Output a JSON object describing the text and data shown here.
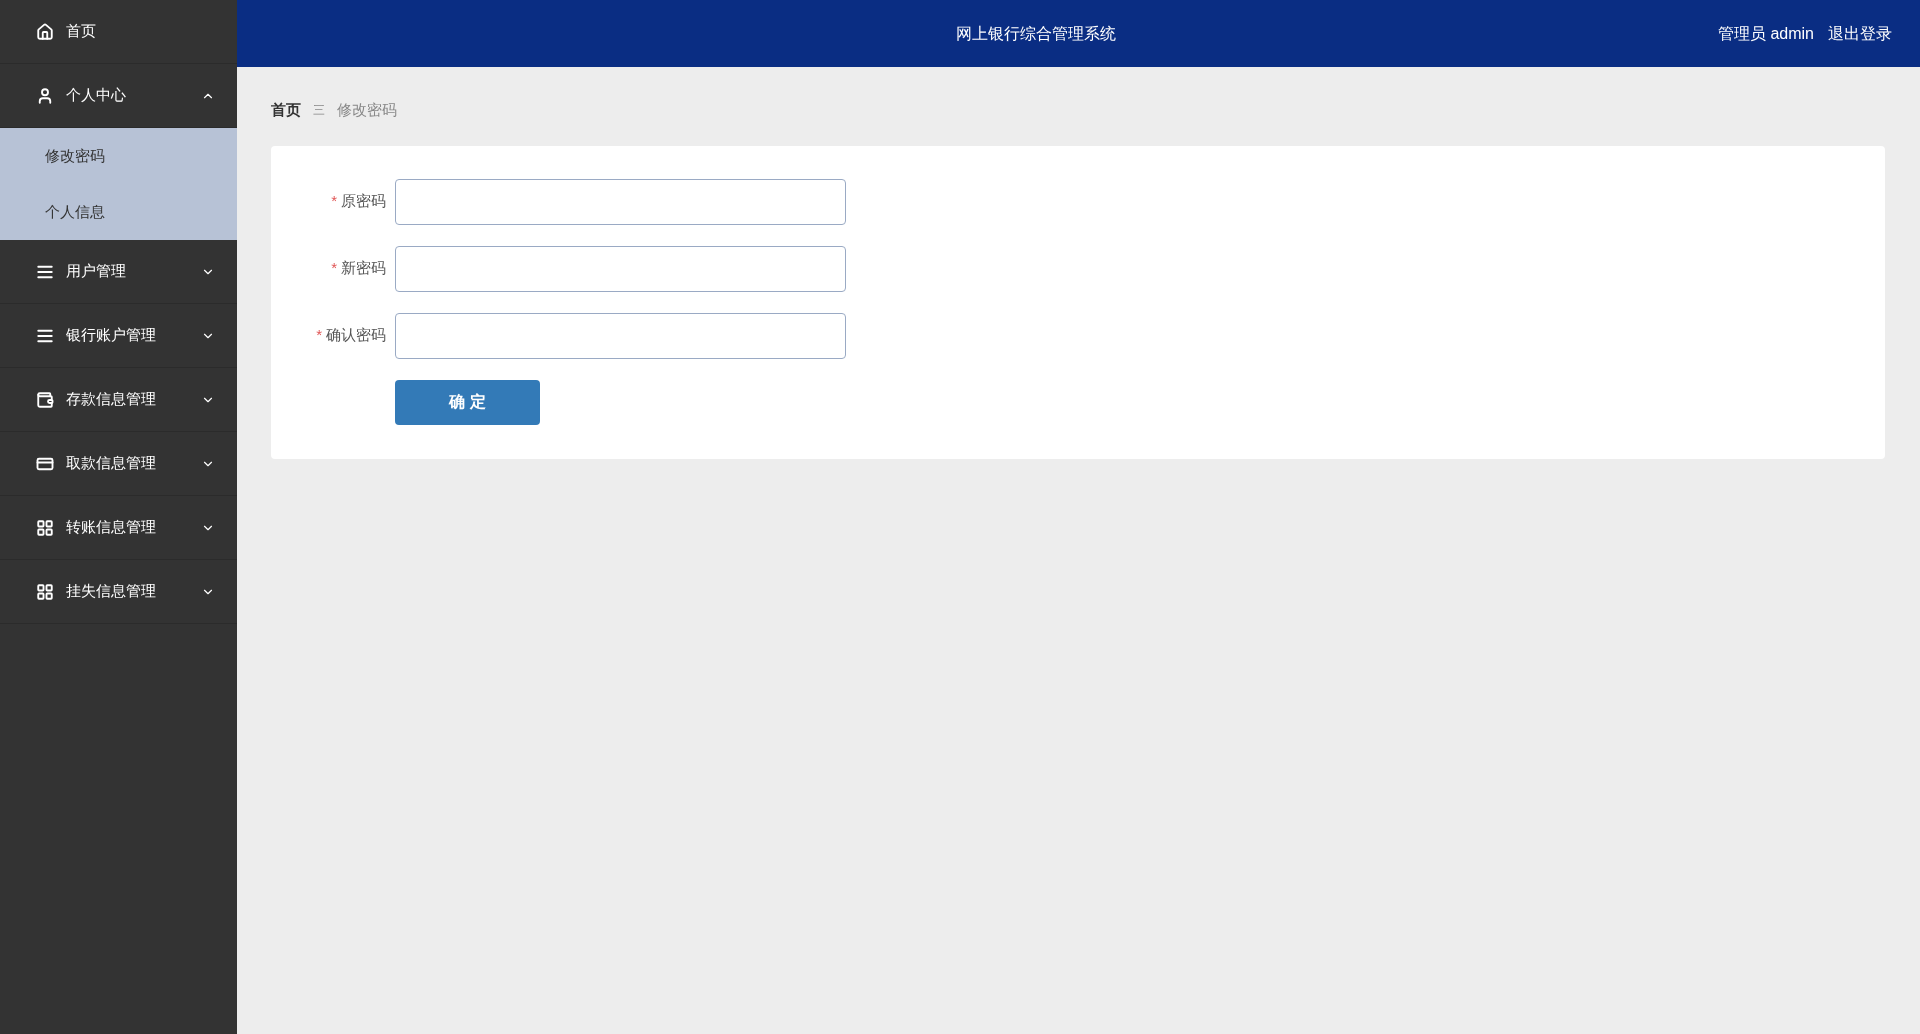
{
  "sidebar": {
    "items": [
      {
        "label": "首页"
      },
      {
        "label": "个人中心",
        "expanded": true,
        "children": [
          {
            "label": "修改密码"
          },
          {
            "label": "个人信息"
          }
        ]
      },
      {
        "label": "用户管理",
        "expanded": false
      },
      {
        "label": "银行账户管理",
        "expanded": false
      },
      {
        "label": "存款信息管理",
        "expanded": false
      },
      {
        "label": "取款信息管理",
        "expanded": false
      },
      {
        "label": "转账信息管理",
        "expanded": false
      },
      {
        "label": "挂失信息管理",
        "expanded": false
      }
    ]
  },
  "header": {
    "title": "网上银行综合管理系统",
    "user": "管理员 admin",
    "logout": "退出登录"
  },
  "breadcrumb": [
    {
      "label": "首页"
    },
    {
      "label": "修改密码"
    }
  ],
  "breadcrumb_separator": "三",
  "form": {
    "fields": [
      {
        "label": "原密码",
        "required": true
      },
      {
        "label": "新密码",
        "required": true
      },
      {
        "label": "确认密码",
        "required": true
      }
    ],
    "required_mark": "*",
    "submit": "确 定"
  }
}
